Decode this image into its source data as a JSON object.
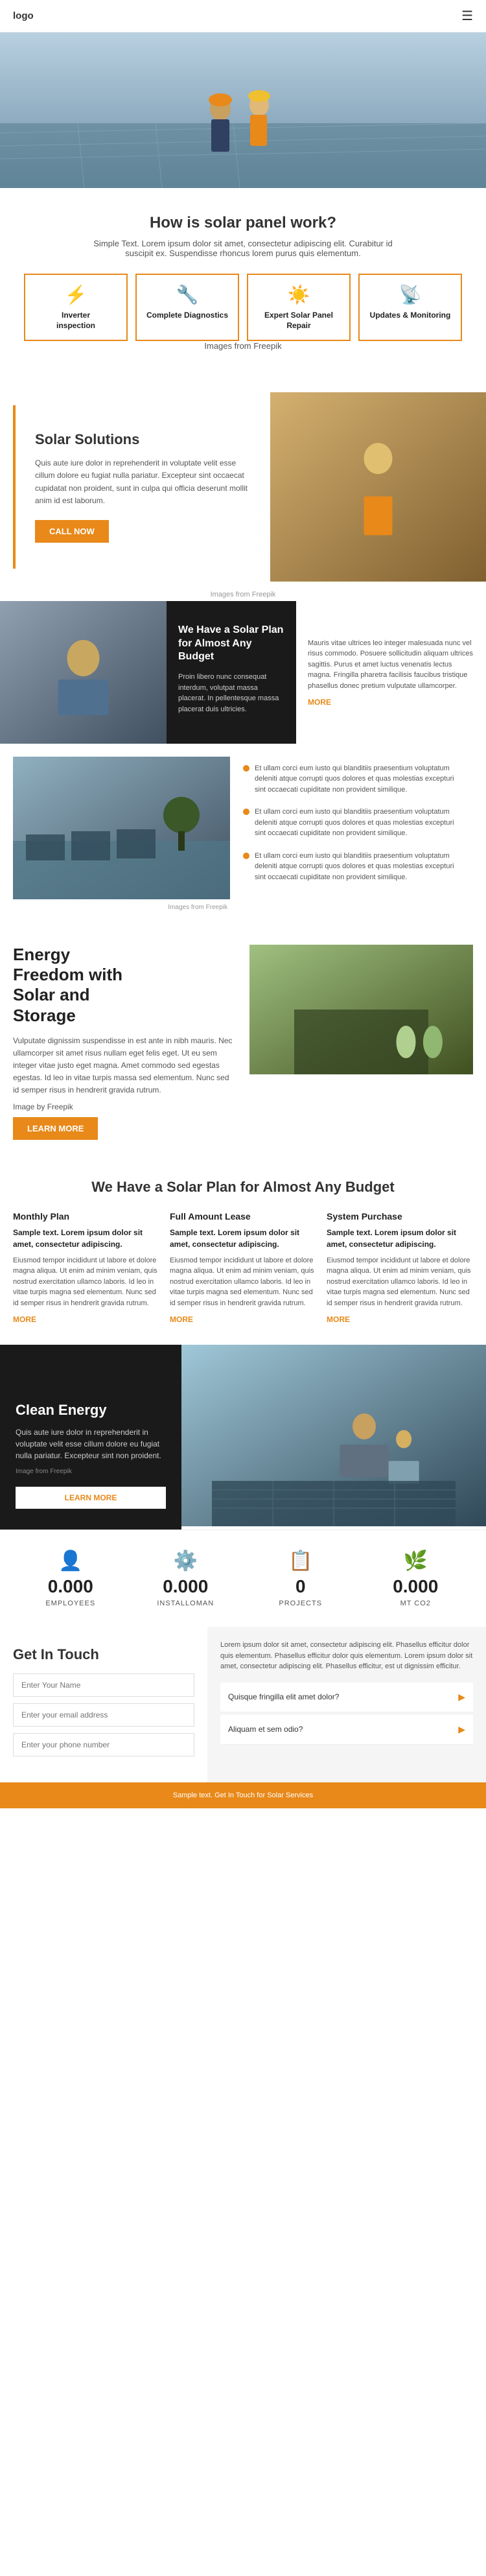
{
  "nav": {
    "logo": "logo",
    "hamburger": "☰"
  },
  "hero": {
    "alt": "Solar panel workers on roof"
  },
  "how": {
    "title": "How is solar panel work?",
    "description": "Simple Text. Lorem ipsum dolor sit amet, consectetur adipiscing elit. Curabitur id suscipit ex. Suspendisse rhoncus lorem purus quis elementum.",
    "images_from": "Images from Freepik",
    "cards": [
      {
        "icon": "⚡",
        "title": "Inverter\ninspection"
      },
      {
        "icon": "🔧",
        "title": "Complete\nDiagnostics"
      },
      {
        "icon": "☀️",
        "title": "Expert Solar Panel\nRepair"
      },
      {
        "icon": "📡",
        "title": "Updates &\nMonitoring"
      }
    ]
  },
  "solar_solutions": {
    "images_from": "Images from Freepik",
    "title": "Solar Solutions",
    "description": "Quis aute iure dolor in reprehenderit in voluptate velit esse cillum dolore eu fugiat nulla pariatur. Excepteur sint occaecat cupidatat non proident, sunt in culpa qui officia deserunt mollit anim id est laborum.",
    "button": "CALL NOW"
  },
  "solar_plan": {
    "dark_title": "We Have a Solar Plan for Almost Any Budget",
    "dark_description": "Proin libero nunc consequat interdum, volutpat massa placerat. In pellentesque massa placerat duis ultricies.",
    "right_text": "Mauris vitae ultrices leo integer malesuada nunc vel risus commodo. Posuere sollicitudin aliquam ultrices sagittis. Purus et amet luctus venenatis lectus magna. Fringilla pharetra facilisis faucibus tristique phasellus donec pretium vulputate ullamcorper.",
    "more": "MORE"
  },
  "bullets": {
    "items": [
      "Et ullam corci eum iusto qui blanditiis praesentium voluptatum deleniti atque corrupti quos dolores et quas molestias excepturi sint occaecati cupiditate non provident similique.",
      "Et ullam corci eum iusto qui blanditiis praesentium voluptatum deleniti atque corrupti quos dolores et quas molestias excepturi sint occaecati cupiditate non provident similique.",
      "Et ullam corci eum iusto qui blanditiis praesentium voluptatum deleniti atque corrupti quos dolores et quas molestias excepturi sint occaecati cupiditate non provident similique."
    ],
    "images_from": "Images from Freepik"
  },
  "energy_freedom": {
    "title": "Energy\nFreedom with\nSolar and\nStorage",
    "description": "Vulputate dignissim suspendisse in est ante in nibh mauris. Nec ullamcorper sit amet risus nullam eget felis eget. Ut eu sem integer vitae justo eget magna. Amet commodo sed egestas egestas. Id leo in vitae turpis massa sed elementum. Nunc sed id semper risus in hendrerit gravida rutrum.",
    "image_note": "Image by Freepik",
    "button": "LEARN MORE"
  },
  "budget": {
    "title": "We Have a Solar Plan for Almost Any Budget",
    "plans": [
      {
        "name": "Monthly Plan",
        "sample": "Sample text. Lorem ipsum dolor sit amet, consectetur adipiscing.",
        "body": "Eiusmod tempor incididunt ut labore et dolore magna aliqua. Ut enim ad minim veniam, quis nostrud exercitation ullamco laboris. Id leo in vitae turpis magna sed elementum. Nunc sed id semper risus in hendrerit gravida rutrum.",
        "more": "MORE"
      },
      {
        "name": "Full Amount Lease",
        "sample": "Sample text. Lorem ipsum dolor sit amet, consectetur adipiscing.",
        "body": "Eiusmod tempor incididunt ut labore et dolore magna aliqua. Ut enim ad minim veniam, quis nostrud exercitation ullamco laboris. Id leo in vitae turpis magna sed elementum. Nunc sed id semper risus in hendrerit gravida rutrum.",
        "more": "MORE"
      },
      {
        "name": "System Purchase",
        "sample": "Sample text. Lorem ipsum dolor sit amet, consectetur adipiscing.",
        "body": "Eiusmod tempor incididunt ut labore et dolore magna aliqua. Ut enim ad minim veniam, quis nostrud exercitation ullamco laboris. Id leo in vitae turpis magna sed elementum. Nunc sed id semper risus in hendrerit gravida rutrum.",
        "more": "MORE"
      }
    ]
  },
  "clean_energy": {
    "title": "Clean Energy",
    "description": "Quis aute iure dolor in reprehenderit in voluptate velit esse cillum dolore eu fugiat nulla pariatur. Excepteur sint non proident.",
    "image_note": "Image from Freepik",
    "button": "LEARN MORE"
  },
  "stats": {
    "items": [
      {
        "icon": "👤",
        "number": "0.000",
        "label": "EMPLOYEES"
      },
      {
        "icon": "⚙️",
        "number": "0.000",
        "label": "INSTALLOMAN"
      },
      {
        "icon": "📋",
        "number": "0",
        "label": "PROJECTS"
      },
      {
        "icon": "🌿",
        "number": "0.000",
        "label": "MT CO2"
      }
    ]
  },
  "contact": {
    "title": "Get In Touch",
    "fields": [
      {
        "placeholder": "Enter Your Name"
      },
      {
        "placeholder": "Enter your email address"
      },
      {
        "placeholder": "Enter your phone number"
      }
    ],
    "description": "Phasellus efficitur dolor",
    "right_description": "Lorem ipsum dolor sit amet, consectetur adipiscing elit. Phasellus efficitur dolor quis elementum. Phasellus efficitur dolor quis elementum. Lorem ipsum dolor sit amet, consectetur adipiscing elit. Phasellus efficitur, est ut dignissim efficitur.",
    "faq_items": [
      "Quisque fringilla elit amet dolor?",
      "Aliquam et sem odio?"
    ]
  },
  "footer": {
    "text": "Sample text. Get In Touch for Solar Services"
  }
}
